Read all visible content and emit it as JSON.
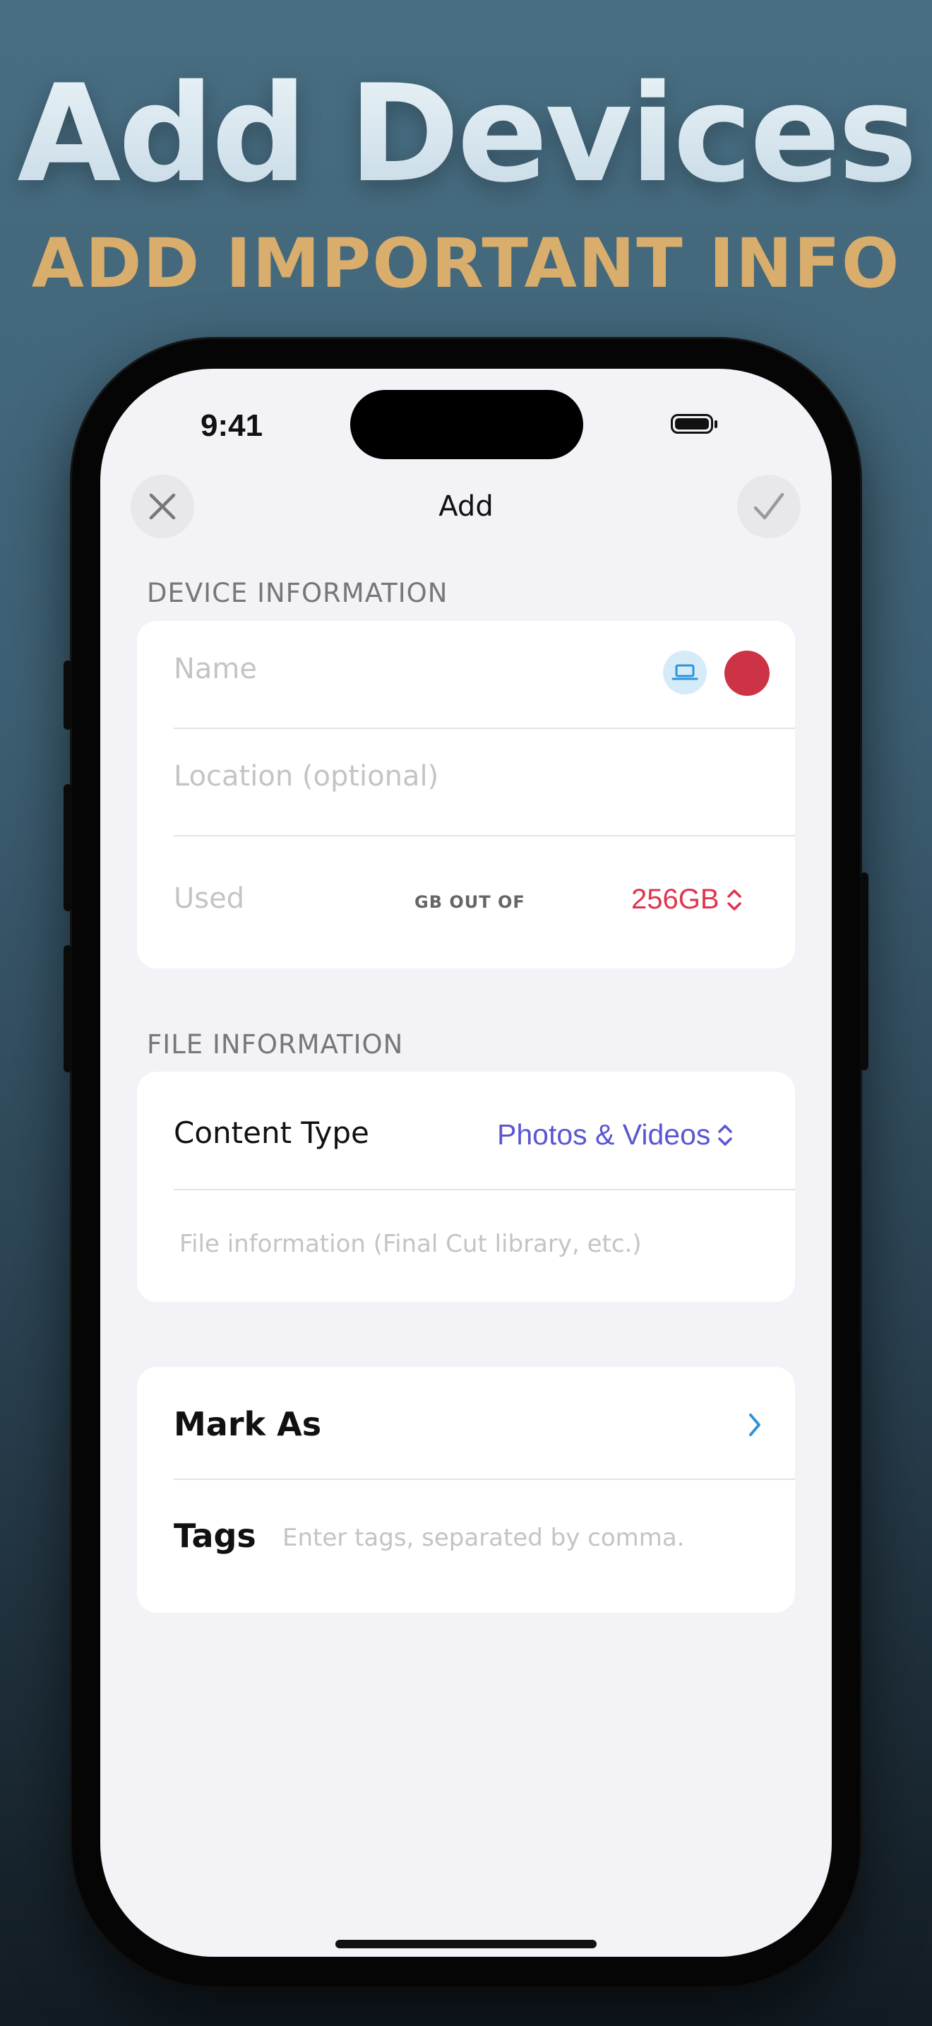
{
  "hero": {
    "title": "Add Devices",
    "subtitle": "ADD IMPORTANT INFO"
  },
  "status_bar": {
    "time": "9:41"
  },
  "nav": {
    "title": "Add",
    "close_icon": "close-icon",
    "confirm_icon": "checkmark-icon"
  },
  "device_information": {
    "header": "DEVICE INFORMATION",
    "name_placeholder": "Name",
    "device_icon": "laptop-icon",
    "color_accent": "#cc3344",
    "location_placeholder": "Location (optional)",
    "used_placeholder": "Used",
    "out_of_label": "GB OUT OF",
    "capacity_value": "256GB"
  },
  "file_information": {
    "header": "FILE INFORMATION",
    "content_type_label": "Content Type",
    "content_type_value": "Photos & Videos",
    "file_info_placeholder": "File information (Final Cut library, etc.)"
  },
  "extra": {
    "mark_as_label": "Mark As",
    "tags_label": "Tags",
    "tags_placeholder": "Enter tags, separated by comma."
  },
  "colors": {
    "hero_subtitle": "#d9ad6c",
    "capacity": "#e0344e",
    "content_type_value": "#5a56d3",
    "chevron": "#2e93d9"
  }
}
